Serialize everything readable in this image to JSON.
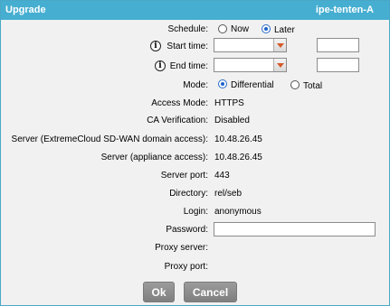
{
  "dialog": {
    "title": "Upgrade",
    "device_name": "ipe-tenten-A"
  },
  "schedule": {
    "label": "Schedule:",
    "options": [
      "Now",
      "Later"
    ],
    "selected": "Later"
  },
  "start_time": {
    "label": "Start time:",
    "date_value": "",
    "time_value": ""
  },
  "end_time": {
    "label": "End time:",
    "date_value": "",
    "time_value": ""
  },
  "mode": {
    "label": "Mode:",
    "options": [
      "Differential",
      "Total"
    ],
    "selected": "Differential"
  },
  "info_rows": [
    {
      "label": "Access Mode:",
      "value": "HTTPS"
    },
    {
      "label": "CA Verification:",
      "value": "Disabled"
    },
    {
      "label": "Server (ExtremeCloud SD-WAN domain access):",
      "value": "10.48.26.45"
    },
    {
      "label": "Server (appliance access):",
      "value": "10.48.26.45"
    },
    {
      "label": "Server port:",
      "value": "443"
    },
    {
      "label": "Directory:",
      "value": "rel/seb"
    },
    {
      "label": "Login:",
      "value": "anonymous"
    }
  ],
  "password": {
    "label": "Password:",
    "value": ""
  },
  "proxy_server": {
    "label": "Proxy server:",
    "value": ""
  },
  "proxy_port": {
    "label": "Proxy port:",
    "value": ""
  },
  "buttons": {
    "ok": "Ok",
    "cancel": "Cancel"
  }
}
